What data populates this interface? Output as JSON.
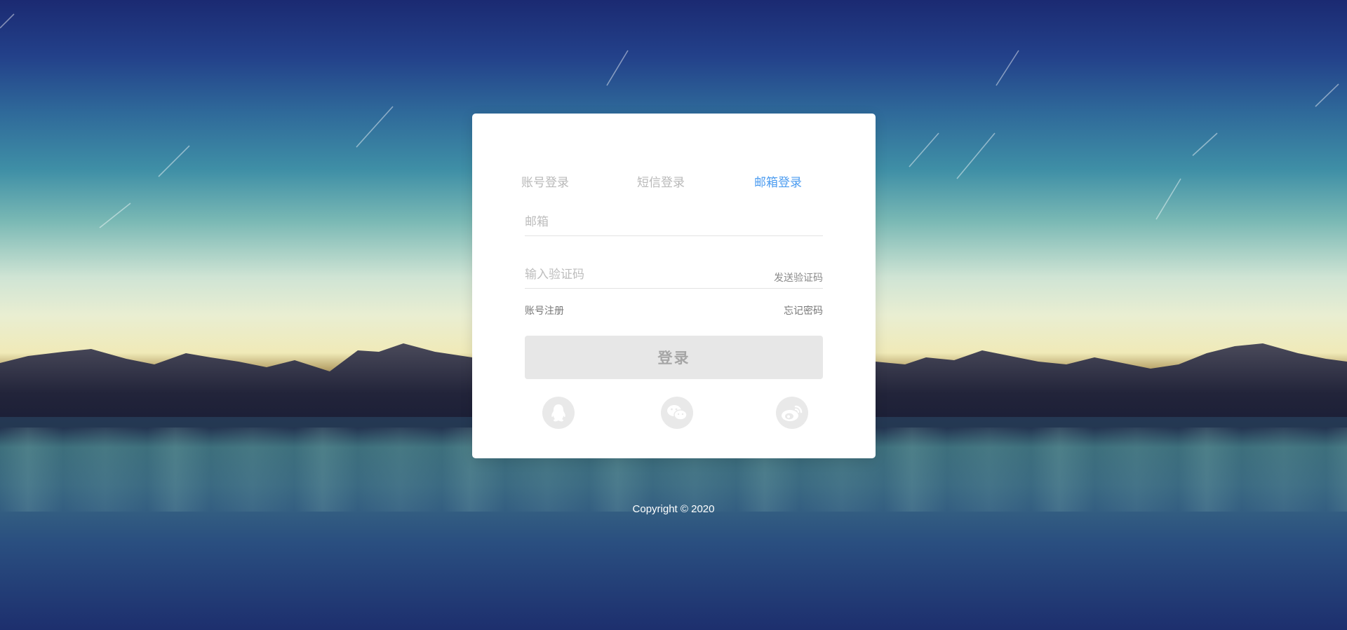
{
  "login_tabs": [
    {
      "label": "账号登录",
      "active": false
    },
    {
      "label": "短信登录",
      "active": false
    },
    {
      "label": "邮箱登录",
      "active": true
    }
  ],
  "email_field": {
    "placeholder": "邮箱",
    "value": ""
  },
  "code_field": {
    "placeholder": "输入验证码",
    "value": ""
  },
  "send_code_label": "发送验证码",
  "register_label": "账号注册",
  "forgot_label": "忘记密码",
  "login_button_label": "登录",
  "social_logins": [
    {
      "icon": "qq-icon"
    },
    {
      "icon": "wechat-icon"
    },
    {
      "icon": "weibo-icon"
    }
  ],
  "copyright": "Copyright © 2020",
  "colors": {
    "active_tab": "#4c9cf0",
    "inactive_tab": "#b9b9b9",
    "login_button_bg": "#e7e7e7",
    "social_icon_bg": "#e9e9e9"
  }
}
